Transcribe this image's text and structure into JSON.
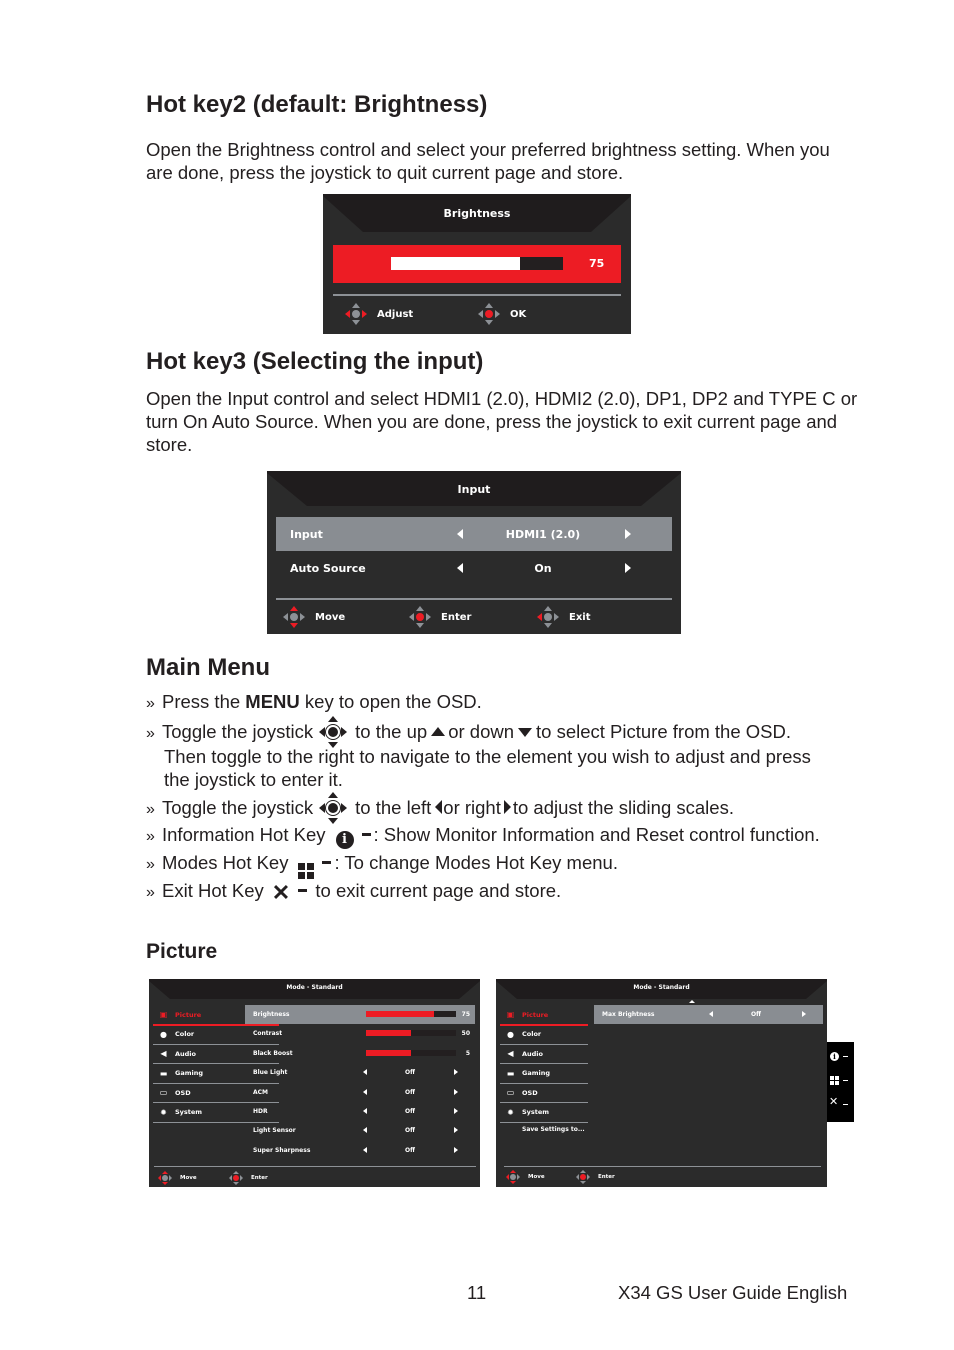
{
  "hotkey2": {
    "heading": "Hot key2 (default: Brightness)",
    "body": "Open the Brightness control and select your preferred brightness setting. When you are done, press the joystick to quit current page and store.",
    "osd": {
      "title": "Brightness",
      "value_label": "75",
      "value": 75,
      "max": 100,
      "footer": [
        {
          "icon": "joystick-left-right-icon",
          "label": "Adjust"
        },
        {
          "icon": "joystick-press-icon",
          "label": "OK"
        }
      ]
    }
  },
  "hotkey3": {
    "heading": "Hot key3 (Selecting the input)",
    "body": "Open the Input control and select HDMI1 (2.0), HDMI2 (2.0), DP1, DP2 and TYPE C or turn On Auto Source. When you are done, press the joystick to exit current page and store.",
    "osd": {
      "title": "Input",
      "rows": [
        {
          "label": "Input",
          "value": "HDMI1 (2.0)",
          "selected": true
        },
        {
          "label": "Auto Source",
          "value": "On",
          "selected": false
        }
      ],
      "footer": [
        {
          "icon": "joystick-up-down-icon",
          "label": "Move"
        },
        {
          "icon": "joystick-press-icon",
          "label": "Enter"
        },
        {
          "icon": "joystick-left-icon",
          "label": "Exit"
        }
      ]
    }
  },
  "main_menu": {
    "heading": "Main Menu",
    "bullets": [
      {
        "pre": "Press the ",
        "bold": "MENU",
        "post": " key to open the OSD."
      },
      {
        "a": "Toggle the joystick",
        "b": "to the up",
        "c": "or down",
        "d": "to select Picture from the OSD.",
        "line2": "Then toggle to the right to navigate to the element you wish to adjust and press",
        "line3": "the joystick to enter it."
      },
      {
        "a": "Toggle the joystick",
        "b": "to the left",
        "c": "or right",
        "d": "to adjust the sliding scales."
      },
      {
        "a": "Information Hot Key",
        "b": ": Show Monitor Information and Reset control function."
      },
      {
        "a": "Modes Hot Key",
        "b": ": To change Modes Hot Key menu."
      },
      {
        "a": "Exit Hot Key",
        "b": " to exit current page and store."
      }
    ]
  },
  "picture": {
    "heading": "Picture",
    "menu": [
      {
        "label": "Picture",
        "icon": "picture-icon",
        "active": true
      },
      {
        "label": "Color",
        "icon": "palette-icon",
        "active": false
      },
      {
        "label": "Audio",
        "icon": "speaker-icon",
        "active": false
      },
      {
        "label": "Gaming",
        "icon": "gamepad-icon",
        "active": false
      },
      {
        "label": "OSD",
        "icon": "osd-icon",
        "active": false
      },
      {
        "label": "System",
        "icon": "gear-icon",
        "active": false
      }
    ],
    "osd1": {
      "title": "Mode - Standard",
      "sliders": [
        {
          "label": "Brightness",
          "value": 75,
          "value_label": "75",
          "fill_pct": 75,
          "selected": true
        },
        {
          "label": "Contrast",
          "value": 50,
          "value_label": "50",
          "fill_pct": 50,
          "selected": false
        },
        {
          "label": "Black Boost",
          "value": 5,
          "value_label": "5",
          "fill_pct": 50,
          "selected": false
        }
      ],
      "options": [
        {
          "label": "Blue Light",
          "value": "Off"
        },
        {
          "label": "ACM",
          "value": "Off"
        },
        {
          "label": "HDR",
          "value": "Off"
        },
        {
          "label": "Light Sensor",
          "value": "Off"
        },
        {
          "label": "Super Sharpness",
          "value": "Off"
        }
      ],
      "footer": [
        {
          "label": "Move"
        },
        {
          "label": "Enter"
        }
      ]
    },
    "osd2": {
      "title": "Mode - Standard",
      "extra_menu": "Save Settings to...",
      "options": [
        {
          "label": "Max Brightness",
          "value": "Off",
          "selected": true
        }
      ],
      "footer": [
        {
          "label": "Move"
        },
        {
          "label": "Enter"
        }
      ],
      "hotkeys": [
        {
          "icon": "info-icon",
          "symbol": "i"
        },
        {
          "icon": "modes-icon",
          "symbol": "▦"
        },
        {
          "icon": "close-icon",
          "symbol": "✕"
        }
      ]
    }
  },
  "footer": {
    "page_number": "11",
    "guide_title": "X34 GS User Guide English"
  },
  "colors": {
    "accent_red": "#ed1c24",
    "osd_bg": "#2b2b2b",
    "osd_selected": "#898d92"
  }
}
